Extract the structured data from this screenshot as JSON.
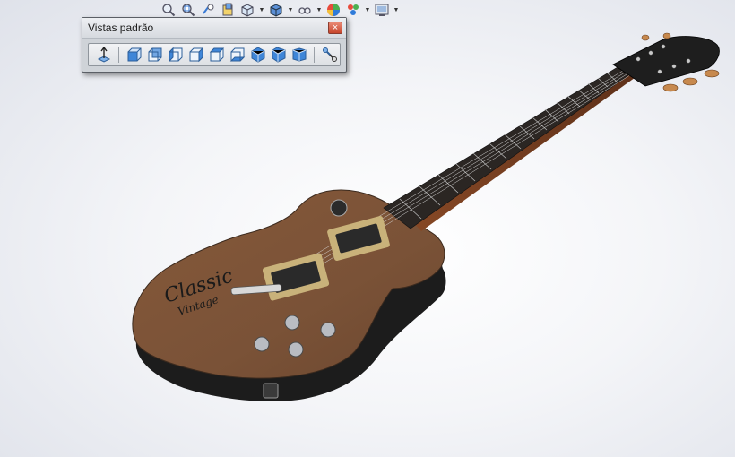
{
  "heads_up_toolbar": {
    "icons": [
      {
        "name": "zoom-to-fit-icon"
      },
      {
        "name": "zoom-to-area-icon"
      },
      {
        "name": "previous-view-icon"
      },
      {
        "name": "section-view-icon"
      },
      {
        "name": "view-orientation-icon",
        "dropdown": true
      },
      {
        "name": "display-style-icon",
        "dropdown": true
      },
      {
        "name": "hide-show-items-icon",
        "dropdown": true
      },
      {
        "name": "edit-appearance-icon"
      },
      {
        "name": "apply-scene-icon",
        "dropdown": true
      },
      {
        "name": "view-settings-icon",
        "dropdown": true
      }
    ]
  },
  "standard_views_panel": {
    "title": "Vistas padrão",
    "close_symbol": "×",
    "buttons": [
      {
        "name": "normal-to-icon"
      },
      {
        "name": "front-view-icon"
      },
      {
        "name": "back-view-icon"
      },
      {
        "name": "left-view-icon"
      },
      {
        "name": "right-view-icon"
      },
      {
        "name": "top-view-icon"
      },
      {
        "name": "bottom-view-icon"
      },
      {
        "name": "isometric-view-icon"
      },
      {
        "name": "trimetric-view-icon"
      },
      {
        "name": "dimetric-view-icon"
      },
      {
        "name": "link-view-icon"
      }
    ]
  },
  "model": {
    "body_logo_line1": "Classic",
    "body_logo_line2": "Vintage",
    "colors": {
      "body_top": "#7a5237",
      "body_side": "#1b1b1b",
      "neck": "#6b3a22",
      "fretboard": "#2a2623",
      "pickup": "#c9b27a",
      "headstock": "#1e1e1e"
    }
  }
}
